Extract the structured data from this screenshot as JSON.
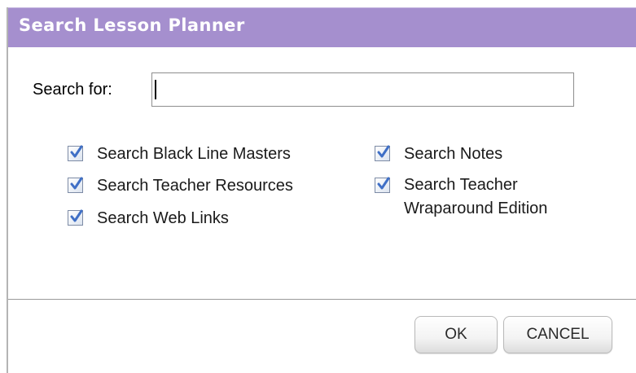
{
  "dialog": {
    "title": "Search Lesson Planner",
    "search_label": "Search for:",
    "search_value": "",
    "options_left": [
      {
        "label": "Search Black Line Masters",
        "checked": true
      },
      {
        "label": "Search Teacher Resources",
        "checked": true
      },
      {
        "label": "Search Web Links",
        "checked": true
      }
    ],
    "options_right": [
      {
        "label": "Search Notes",
        "checked": true
      },
      {
        "label": "Search Teacher\nWraparound Edition",
        "checked": true
      }
    ],
    "ok_label": "OK",
    "cancel_label": "CANCEL"
  },
  "colors": {
    "titlebar": "#a58fce",
    "check": "#3f6fc6"
  },
  "icons": {
    "checkbox": "checkbox-checked-icon"
  }
}
